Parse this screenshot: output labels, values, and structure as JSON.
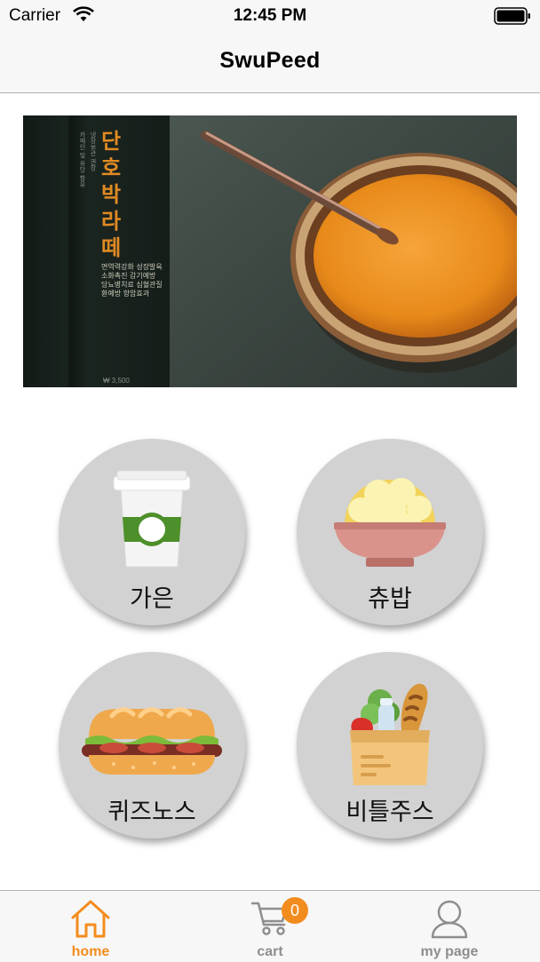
{
  "status_bar": {
    "carrier": "Carrier",
    "time": "12:45 PM"
  },
  "nav": {
    "title": "SwuPeed"
  },
  "banner": {
    "title": "단호박라떼",
    "side_text": [
      "카페인 및 유당 함유",
      "냉장보관 권장",
      "단호박라떼 소개",
      "음료"
    ],
    "description": "면역력강화 성장발육 소화촉진 감기예방 당뇨병치료 심혈관질환예방 항암효과",
    "price": "₩ 3,500"
  },
  "menu": [
    {
      "label": "가은",
      "icon": "coffee-cup-icon"
    },
    {
      "label": "츄밥",
      "icon": "rice-bowl-icon"
    },
    {
      "label": "퀴즈노스",
      "icon": "sandwich-icon"
    },
    {
      "label": "비틀주스",
      "icon": "grocery-bag-icon"
    }
  ],
  "tabs": [
    {
      "label": "home",
      "icon": "home-icon",
      "active": true
    },
    {
      "label": "cart",
      "icon": "cart-icon",
      "badge": "0"
    },
    {
      "label": "my page",
      "icon": "person-icon"
    }
  ],
  "colors": {
    "accent": "#f38c1e",
    "inactive": "#8e8e8e",
    "circle": "#d2d2d2"
  }
}
